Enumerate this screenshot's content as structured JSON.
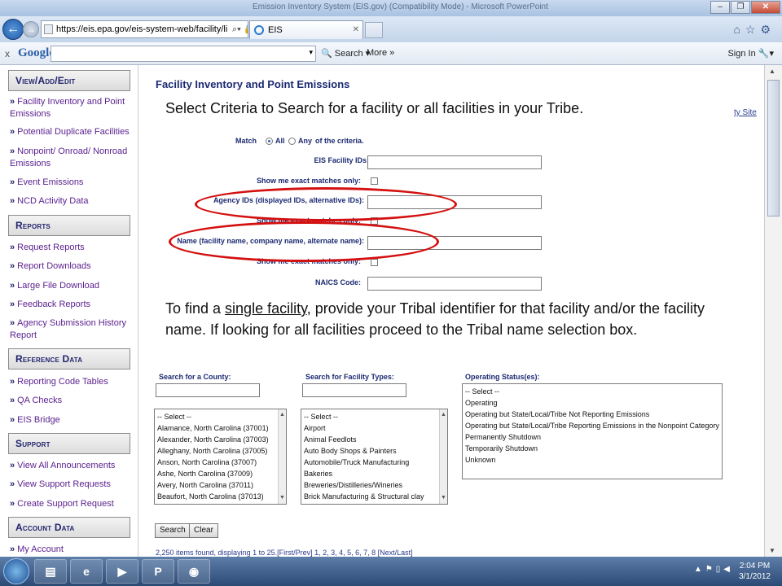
{
  "window": {
    "title": "Emission Inventory System (EIS.gov) (Compatibility Mode) - Microsoft PowerPoint"
  },
  "browser": {
    "url": "https://eis.epa.gov/eis-system-web/facility/li",
    "tab_label": "EIS",
    "toolbar_name": "Google",
    "search_label": "Search",
    "more_label": "More",
    "signin_label": "Sign In"
  },
  "sidebar": {
    "sections": [
      {
        "title": "View/Add/Edit",
        "items": [
          "Facility Inventory and Point Emissions",
          "Potential Duplicate Facilities",
          "Nonpoint/ Onroad/ Nonroad Emissions",
          "Event Emissions",
          "NCD Activity Data"
        ]
      },
      {
        "title": "Reports",
        "items": [
          "Request Reports",
          "Report Downloads",
          "Large File Download",
          "Feedback Reports",
          "Agency Submission History Report"
        ]
      },
      {
        "title": "Reference Data",
        "items": [
          "Reporting Code Tables",
          "QA Checks",
          "EIS Bridge"
        ]
      },
      {
        "title": "Support",
        "items": [
          "View All Announcements",
          "View Support Requests",
          "Create Support Request"
        ]
      },
      {
        "title": "Account Data",
        "items": [
          "My Account"
        ]
      }
    ]
  },
  "main": {
    "title": "Facility Inventory and Point Emissions",
    "tribal_link": "ty Site",
    "match_label": "Match",
    "match_all": "All",
    "match_any": "Any",
    "match_suffix": "of the criteria.",
    "fields": {
      "eis_ids": "EIS Facility IDs:",
      "exact1": "Show me exact matches only:",
      "agency_ids": "Agency IDs (displayed IDs, alternative IDs):",
      "exact2": "Show me exact matches only:",
      "name": "Name (facility name, company name, alternate name):",
      "exact3": "Show me exact matches only:",
      "naics": "NAICS Code:"
    },
    "county_label": "Search for a County:",
    "county_options": [
      "-- Select --",
      "Alamance, North Carolina (37001)",
      "Alexander, North Carolina (37003)",
      "Alleghany, North Carolina (37005)",
      "Anson, North Carolina (37007)",
      "Ashe, North Carolina (37009)",
      "Avery, North Carolina (37011)",
      "Beaufort, North Carolina (37013)"
    ],
    "type_label": "Search for Facility Types:",
    "type_options": [
      "-- Select --",
      "Airport",
      "Animal Feedlots",
      "Auto Body Shops & Painters",
      "Automobile/Truck Manufacturing",
      "Bakeries",
      "Breweries/Distilleries/Wineries",
      "Brick Manufacturing & Structural clay"
    ],
    "status_label": "Operating Status(es):",
    "status_options": [
      "-- Select --",
      "Operating",
      "Operating but State/Local/Tribe Not Reporting Emissions",
      "Operating but State/Local/Tribe Reporting Emissions in the Nonpoint Category",
      "Permanently Shutdown",
      "Temporarily Shutdown",
      "Unknown"
    ],
    "search_button": "Search",
    "clear_button": "Clear",
    "results_text": "2,250 items found, displaying 1 to 25.[First/Prev] 1, 2, 3, 4, 5, 6, 7, 8 [Next/Last]"
  },
  "callouts": {
    "top": "Select Criteria to Search for a facility or all facilities in your Tribe.",
    "bottom_pre": "To find a ",
    "bottom_underlined": "single facility",
    "bottom_post": ", provide your Tribal identifier for that facility and/or the facility name.  If looking for all facilities proceed to the Tribal name selection box."
  },
  "taskbar": {
    "time": "2:04 PM",
    "date": "3/1/2012"
  },
  "colors": {
    "annotation_red": "#d41010",
    "nav_blue": "#1c2a72",
    "link_purple": "#5a1f8e"
  }
}
